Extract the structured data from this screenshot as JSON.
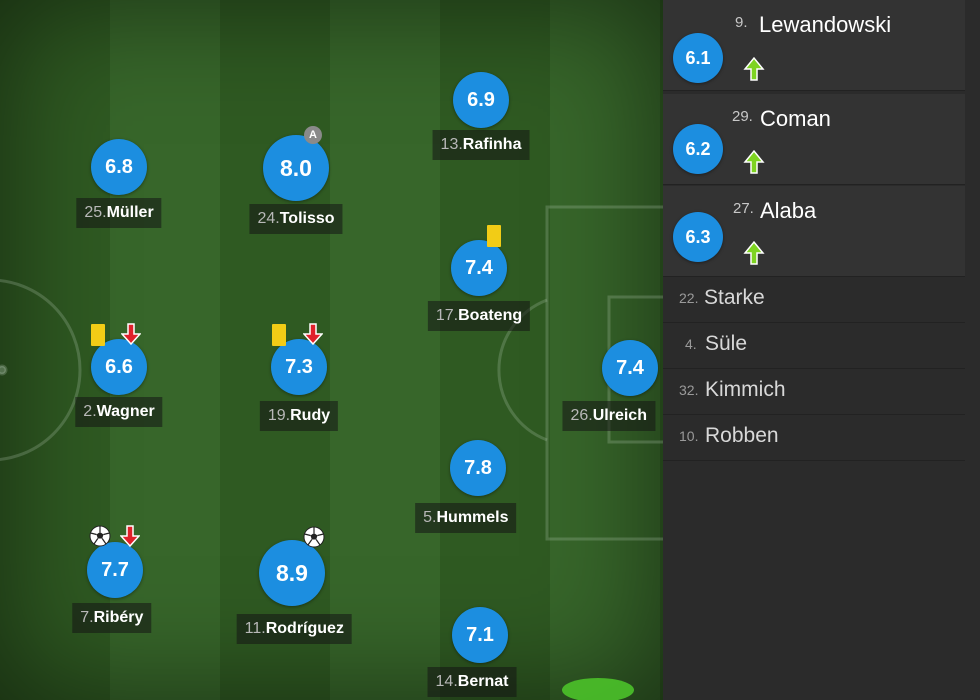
{
  "players": [
    {
      "number": "25.",
      "name": "Müller",
      "rating": "6.8"
    },
    {
      "number": "24.",
      "name": "Tolisso",
      "rating": "8.0",
      "badge": "A"
    },
    {
      "number": "13.",
      "name": "Rafinha",
      "rating": "6.9"
    },
    {
      "number": "17.",
      "name": "Boateng",
      "rating": "7.4"
    },
    {
      "number": "2.",
      "name": "Wagner",
      "rating": "6.6"
    },
    {
      "number": "19.",
      "name": "Rudy",
      "rating": "7.3"
    },
    {
      "number": "26.",
      "name": "Ulreich",
      "rating": "7.4"
    },
    {
      "number": "5.",
      "name": "Hummels",
      "rating": "7.8"
    },
    {
      "number": "7.",
      "name": "Ribéry",
      "rating": "7.7"
    },
    {
      "number": "11.",
      "name": "Rodríguez",
      "rating": "8.9"
    },
    {
      "number": "14.",
      "name": "Bernat",
      "rating": "7.1"
    }
  ],
  "substitutes": [
    {
      "number": "9.",
      "name": "Lewandowski",
      "rating": "6.1"
    },
    {
      "number": "29.",
      "name": "Coman",
      "rating": "6.2"
    },
    {
      "number": "27.",
      "name": "Alaba",
      "rating": "6.3"
    }
  ],
  "reserves": [
    {
      "number": "22.",
      "name": "Starke"
    },
    {
      "number": "4.",
      "name": "Süle"
    },
    {
      "number": "32.",
      "name": "Kimmich"
    },
    {
      "number": "10.",
      "name": "Robben"
    }
  ],
  "colors": {
    "rating_bubble": "#1c8ee0",
    "yellow_card": "#f2cc16",
    "sub_off_arrow": "#e0202a",
    "sub_on_arrow": "#7ed321"
  }
}
